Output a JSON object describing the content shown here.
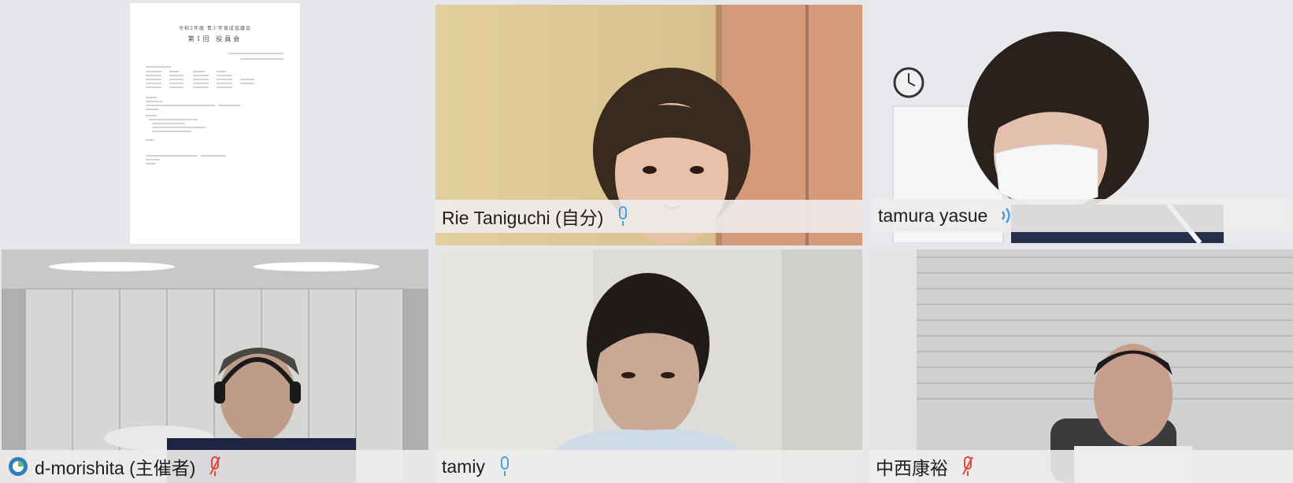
{
  "participants": [
    {
      "name": "",
      "type": "screen-share"
    },
    {
      "name": "Rie Taniguchi (自分)",
      "mic": "mic-on-icon"
    },
    {
      "name": "tamura yasue",
      "mic": "speaking-icon"
    },
    {
      "name": "d-morishita (主催者)",
      "mic": "mic-muted-icon",
      "badge": "host-icon"
    },
    {
      "name": "tamiy",
      "mic": "mic-on-icon"
    },
    {
      "name": "中西康裕",
      "mic": "mic-muted-icon"
    }
  ],
  "shared_document": {
    "title": "令和2年度 青少年育成協議会",
    "subtitle": "第1回 役員会"
  },
  "colors": {
    "active_speaker_border": "#4fa3db",
    "mic_on": "#4b9fd6",
    "mic_muted": "#e0473c"
  }
}
